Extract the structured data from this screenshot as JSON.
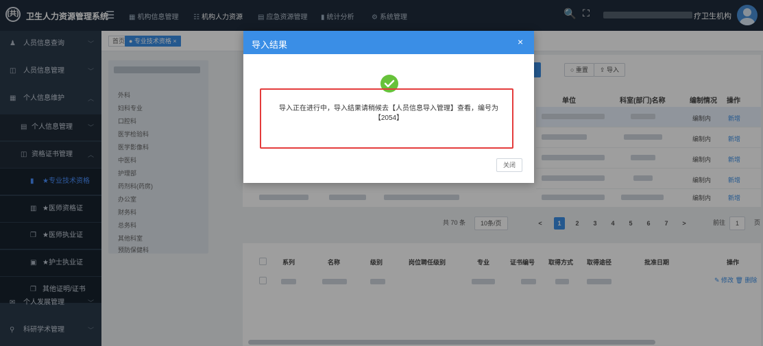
{
  "header": {
    "logo_text": "(共)",
    "app_name": "卫生人力资源管理系统",
    "menu_icon": "menu-toggle-icon",
    "nav": [
      {
        "label": "机构信息管理"
      },
      {
        "label": "机构人力资源"
      },
      {
        "label": "应急资源管理"
      },
      {
        "label": "统计分析"
      },
      {
        "label": "系统管理"
      }
    ],
    "org_name_visible": "疗卫生机构"
  },
  "sidebar": {
    "items": [
      {
        "label": "人员信息查询"
      },
      {
        "label": "人员信息管理"
      },
      {
        "label": "个人信息维护"
      },
      {
        "label": "个人信息管理"
      },
      {
        "label": "资格证书管理"
      },
      {
        "label": "★专业技术资格"
      },
      {
        "label": "★医师资格证"
      },
      {
        "label": "★医师执业证"
      },
      {
        "label": "★护士执业证"
      },
      {
        "label": "其他证明/证书"
      },
      {
        "label": "个人发展管理"
      },
      {
        "label": "科研学术管理"
      }
    ]
  },
  "tabs": {
    "home": "首页",
    "active": "● 专业技术资格 ×"
  },
  "tree": {
    "items": [
      "外科",
      "妇科专业",
      "口腔科",
      "医学检验科",
      "医学影像科",
      "中医科",
      "护理部",
      "药剂科(药房)",
      "办公室",
      "财务科",
      "总务科",
      "其他科室",
      "预防保健科"
    ]
  },
  "toolbar": {
    "reset_label": "○ 重置",
    "import_label": "⇪ 导入"
  },
  "table_top": {
    "headers": [
      "单位",
      "科室(部门)名称",
      "编制情况",
      "操作"
    ],
    "rows": [
      {
        "status": "编制内",
        "op": "新增"
      },
      {
        "status": "编制内",
        "op": "新增"
      },
      {
        "status": "编制内",
        "op": "新增"
      },
      {
        "status": "编制内",
        "op": "新增"
      },
      {
        "status": "编制内",
        "op": "新增"
      }
    ]
  },
  "pager": {
    "total": "共 70 条",
    "page_size": "10条/页",
    "pages": [
      "1",
      "2",
      "3",
      "4",
      "5",
      "6",
      "7"
    ],
    "next": ">",
    "prev": "<",
    "goto_label": "前往",
    "goto_value": "1",
    "page_unit": "页"
  },
  "table_bottom": {
    "headers": [
      "系列",
      "名称",
      "级别",
      "岗位聘任级别",
      "专业",
      "证书编号",
      "取得方式",
      "取得途径",
      "批准日期",
      "操作"
    ],
    "row_ops": "✎ 修改  🗑 删除"
  },
  "modal": {
    "title": "导入结果",
    "close_x": "×",
    "message": "导入正在进行中，导入结果请稍候去【人员信息导入管理】查看，编号为【2054】",
    "close_button": "关闭"
  }
}
